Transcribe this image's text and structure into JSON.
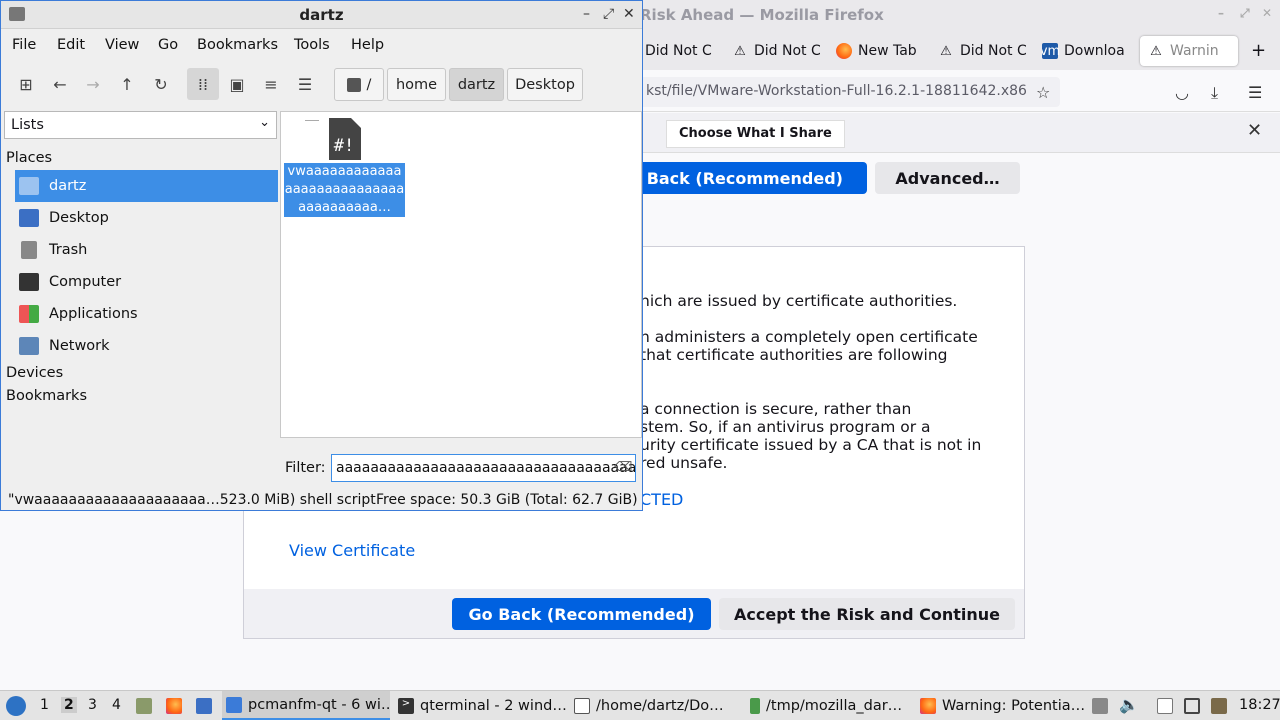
{
  "firefox": {
    "window_title": "Risk Ahead — Mozilla Firefox",
    "tabs": [
      {
        "label": "Did Not C",
        "icon": "warning-icon"
      },
      {
        "label": "Did Not C",
        "icon": "warning-icon"
      },
      {
        "label": "New Tab",
        "icon": "firefox-icon"
      },
      {
        "label": "Did Not C",
        "icon": "warning-icon"
      },
      {
        "label": "Downloa",
        "icon": "vmware-icon"
      },
      {
        "label": "Warnin",
        "icon": "warning-icon",
        "active": true
      }
    ],
    "new_tab": "+",
    "url": "kst/file/VMware-Workstation-Full-16.2.1-18811642.x86",
    "notification_button": "Choose What I Share",
    "go_back_top": "o Back (Recommended)",
    "advanced": "Advanced…",
    "text_lines": [
      "hich are issued by certificate authorities.",
      "h administers a completely open certificate",
      " that certificate authorities are following",
      "a connection is secure, rather than",
      "stem. So, if an antivirus program or a",
      "urity certificate issued by a CA that is not in",
      "red unsafe."
    ],
    "error_code_fragment": "CTED",
    "view_certificate": "View Certificate",
    "go_back": "Go Back (Recommended)",
    "accept": "Accept the Risk and Continue"
  },
  "filemanager": {
    "title": "dartz",
    "menu": [
      "File",
      "Edit",
      "View",
      "Go",
      "Bookmarks",
      "Tools",
      "Help"
    ],
    "breadcrumbs": [
      "/",
      "home",
      "dartz",
      "Desktop"
    ],
    "active_crumb": "dartz",
    "side_mode": "Lists",
    "places_header": "Places",
    "places": [
      {
        "label": "dartz",
        "icon": "home-folder-icon",
        "selected": true
      },
      {
        "label": "Desktop",
        "icon": "desktop-icon"
      },
      {
        "label": "Trash",
        "icon": "trash-icon"
      },
      {
        "label": "Computer",
        "icon": "computer-icon"
      },
      {
        "label": "Applications",
        "icon": "applications-icon"
      },
      {
        "label": "Network",
        "icon": "network-icon"
      }
    ],
    "devices_header": "Devices",
    "bookmarks_header": "Bookmarks",
    "file_name": "vwaaaaaaaaaaaaaaaaaaaaaaaaaaaaaaaaaaaaa…",
    "file_icon_text": "#!",
    "filter_label": "Filter:",
    "filter_value": "aaaaaaaaaaaaaaaaaaaaaaaaaaaaaaaaaaa",
    "status_left": "\"vwaaaaaaaaaaaaaaaaaaaa…523.0 MiB) shell script",
    "status_right": "Free space: 50.3 GiB (Total: 62.7 GiB)"
  },
  "taskbar": {
    "desktops": [
      "1",
      "2",
      "3",
      "4"
    ],
    "active_desktop": "2",
    "tasks": [
      {
        "label": "pcmanfm-qt - 6 wi…",
        "icon": "folder-icon",
        "active": true
      },
      {
        "label": "qterminal - 2 wind…",
        "icon": "terminal-icon"
      },
      {
        "label": "/home/dartz/Do…",
        "icon": "text-editor-icon"
      },
      {
        "label": "/tmp/mozilla_dar…",
        "icon": "archive-icon"
      },
      {
        "label": "Warning: Potentia…",
        "icon": "firefox-icon"
      }
    ],
    "clock": "18:27"
  },
  "colors": {
    "selection": "#3d8ee6",
    "firefox_blue": "#0061e0"
  }
}
